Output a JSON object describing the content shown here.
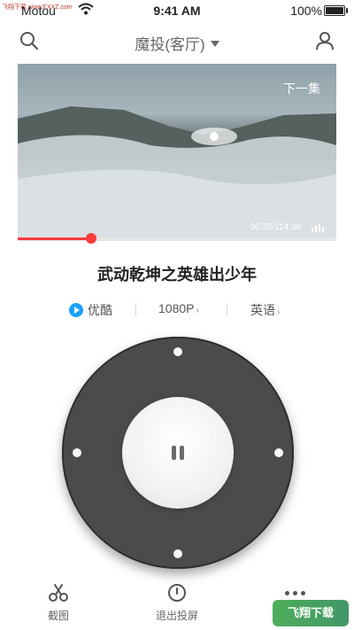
{
  "status_bar": {
    "watermark": "飞翔下载 www.FXXZ.com",
    "carrier": "Motou",
    "time": "9:41 AM",
    "battery": "100%",
    "battery_level": 1.0
  },
  "header": {
    "title": "魔投(客厅)",
    "left_icon": "search-icon",
    "right_icon": "user-icon"
  },
  "player": {
    "next_episode": "下一集",
    "time": "36:32/114:38",
    "progress": 0.23,
    "accent_color": "#ff3b3b"
  },
  "video_title": "武动乾坤之英雄出少年",
  "options": {
    "source": "优酷",
    "resolution": "1080P",
    "language": "英语"
  },
  "remote": {
    "center_icon": "pause-icon",
    "direction_icons": [
      "up-dot",
      "down-dot",
      "left-dot",
      "right-dot"
    ]
  },
  "bottom_bar": {
    "screenshot_label": "截图",
    "exit_label": "退出投屏",
    "more_icon": "more-icon"
  },
  "watermark_bottom": "飞翔下载"
}
